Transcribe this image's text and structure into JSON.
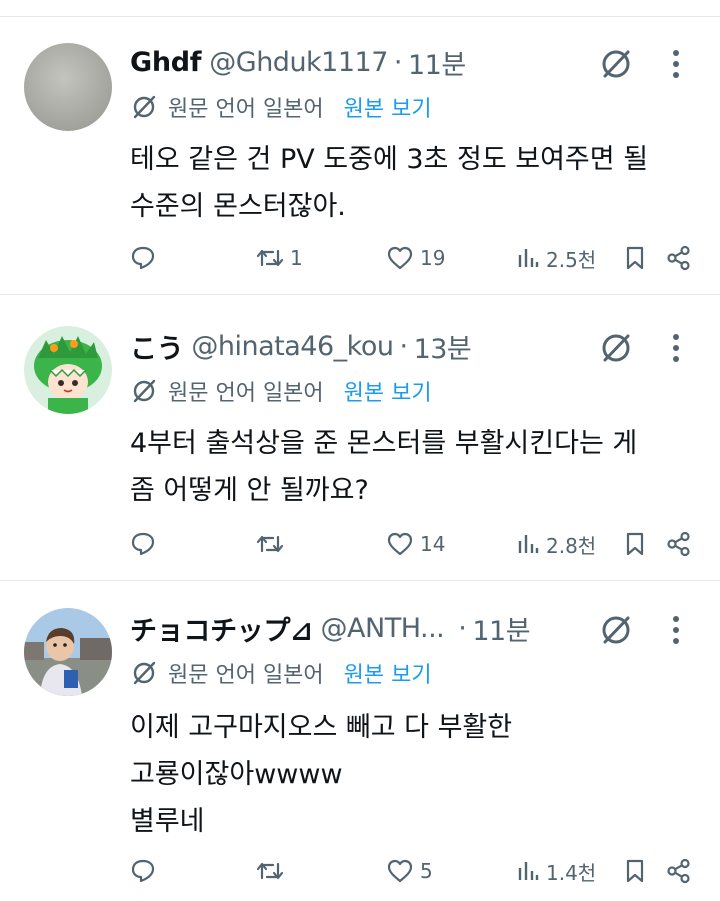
{
  "translate_label": "원문 언어 일본어",
  "translate_link": "원본 보기",
  "colors": {
    "accent": "#1d9bf0",
    "muted": "#536471",
    "text": "#0f1419",
    "divider": "#e6e9ec"
  },
  "tweets": [
    {
      "name": "Ghdf",
      "handle": "@Ghduk1117",
      "dot": "·",
      "time": "11분",
      "text": "테오 같은 건 PV 도중에 3초 정도 보여주면 될\n수준의 몬스터잖아.",
      "replies": "",
      "retweets": "1",
      "likes": "19",
      "views": "2.5천",
      "avatar_icon": "gray-blur-avatar"
    },
    {
      "name": "こう",
      "handle": "@hinata46_kou",
      "dot": "·",
      "time": "13분",
      "text": "4부터 출석상을 준 몬스터를 부활시킨다는 게\n좀 어떻게 안 될까요?",
      "replies": "",
      "retweets": "",
      "likes": "14",
      "views": "2.8천",
      "avatar_icon": "green-dragon-costume-avatar"
    },
    {
      "name": "チョコチップ⊿",
      "handle": "@ANTH...",
      "dot": "·",
      "time": "11분",
      "text": "이제 고구마지오스 빼고 다 부활한\n고룡이잖아wwww\n별루네",
      "replies": "",
      "retweets": "",
      "likes": "5",
      "views": "1.4천",
      "avatar_icon": "child-photo-avatar"
    }
  ]
}
